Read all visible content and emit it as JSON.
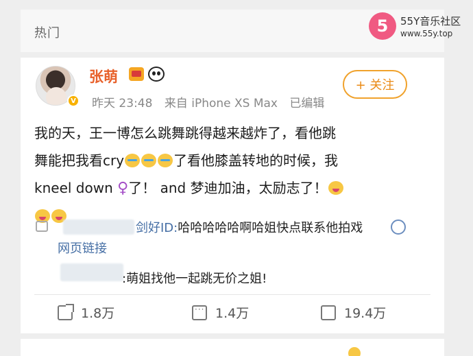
{
  "top": {
    "title": "热门"
  },
  "watermark": {
    "logo": "5",
    "name": "55Y音乐社区",
    "url": "www.55y.top"
  },
  "post": {
    "username": "张萌",
    "meta": {
      "time": "昨天 23:48",
      "source": "来自 iPhone XS Max",
      "edited": "已编辑"
    },
    "follow_label": "+ 关注",
    "text": {
      "line1": "我的天，王一博怎么跳舞跳得越来越炸了，看他跳",
      "line2a": "舞能把我看cry",
      "line2b": "了看他膝盖转地的时候，我",
      "line3a": "kneel down ",
      "line3b": "了！ and 梦迪加油，太励志了！"
    },
    "icons": {
      "crown": "crown-icon",
      "panda": "panda-icon",
      "cry": "crying-face-emoji",
      "drool": "drooling-face-emoji",
      "female": "♀",
      "link": "link-icon"
    }
  },
  "comments": {
    "line1_suffix": "剑好ID:",
    "line1_text": "哈哈哈哈哈啊哈姐快点联系他拍戏",
    "link_label": "网页链接",
    "line2": ":萌姐找他一起跳无价之姐!"
  },
  "actions": {
    "share_count": "1.8万",
    "comment_count": "1.4万",
    "like_count": "19.4万"
  }
}
